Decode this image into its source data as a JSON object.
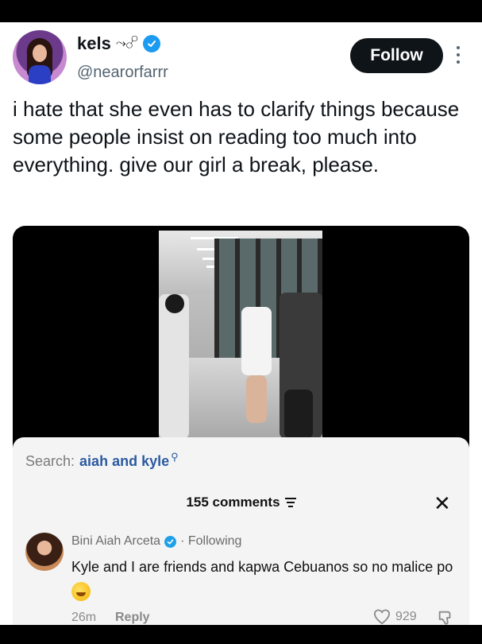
{
  "author": {
    "name": "kels",
    "name_glyph": "⤳☍",
    "handle": "@nearorfarrr"
  },
  "follow_button": {
    "label": "Follow"
  },
  "tweet": {
    "text": "i hate that she even has to clarify things because some people insist on reading too much into everything. give our girl a break, please."
  },
  "comments_panel": {
    "search_label": "Search:",
    "search_query": "aiah and kyle",
    "comments_count": "155 comments",
    "close_icon": "close-icon",
    "comment": {
      "author": "Bini Aiah Arceta",
      "following": "· Following",
      "text": "Kyle and I are friends and kapwa Cebuanos so no malice po",
      "time": "26m",
      "reply": "Reply",
      "likes": "929"
    }
  },
  "colors": {
    "follow_bg": "#0f1419",
    "verified": "#1d9bf0",
    "search_query": "#2c5aa0"
  }
}
